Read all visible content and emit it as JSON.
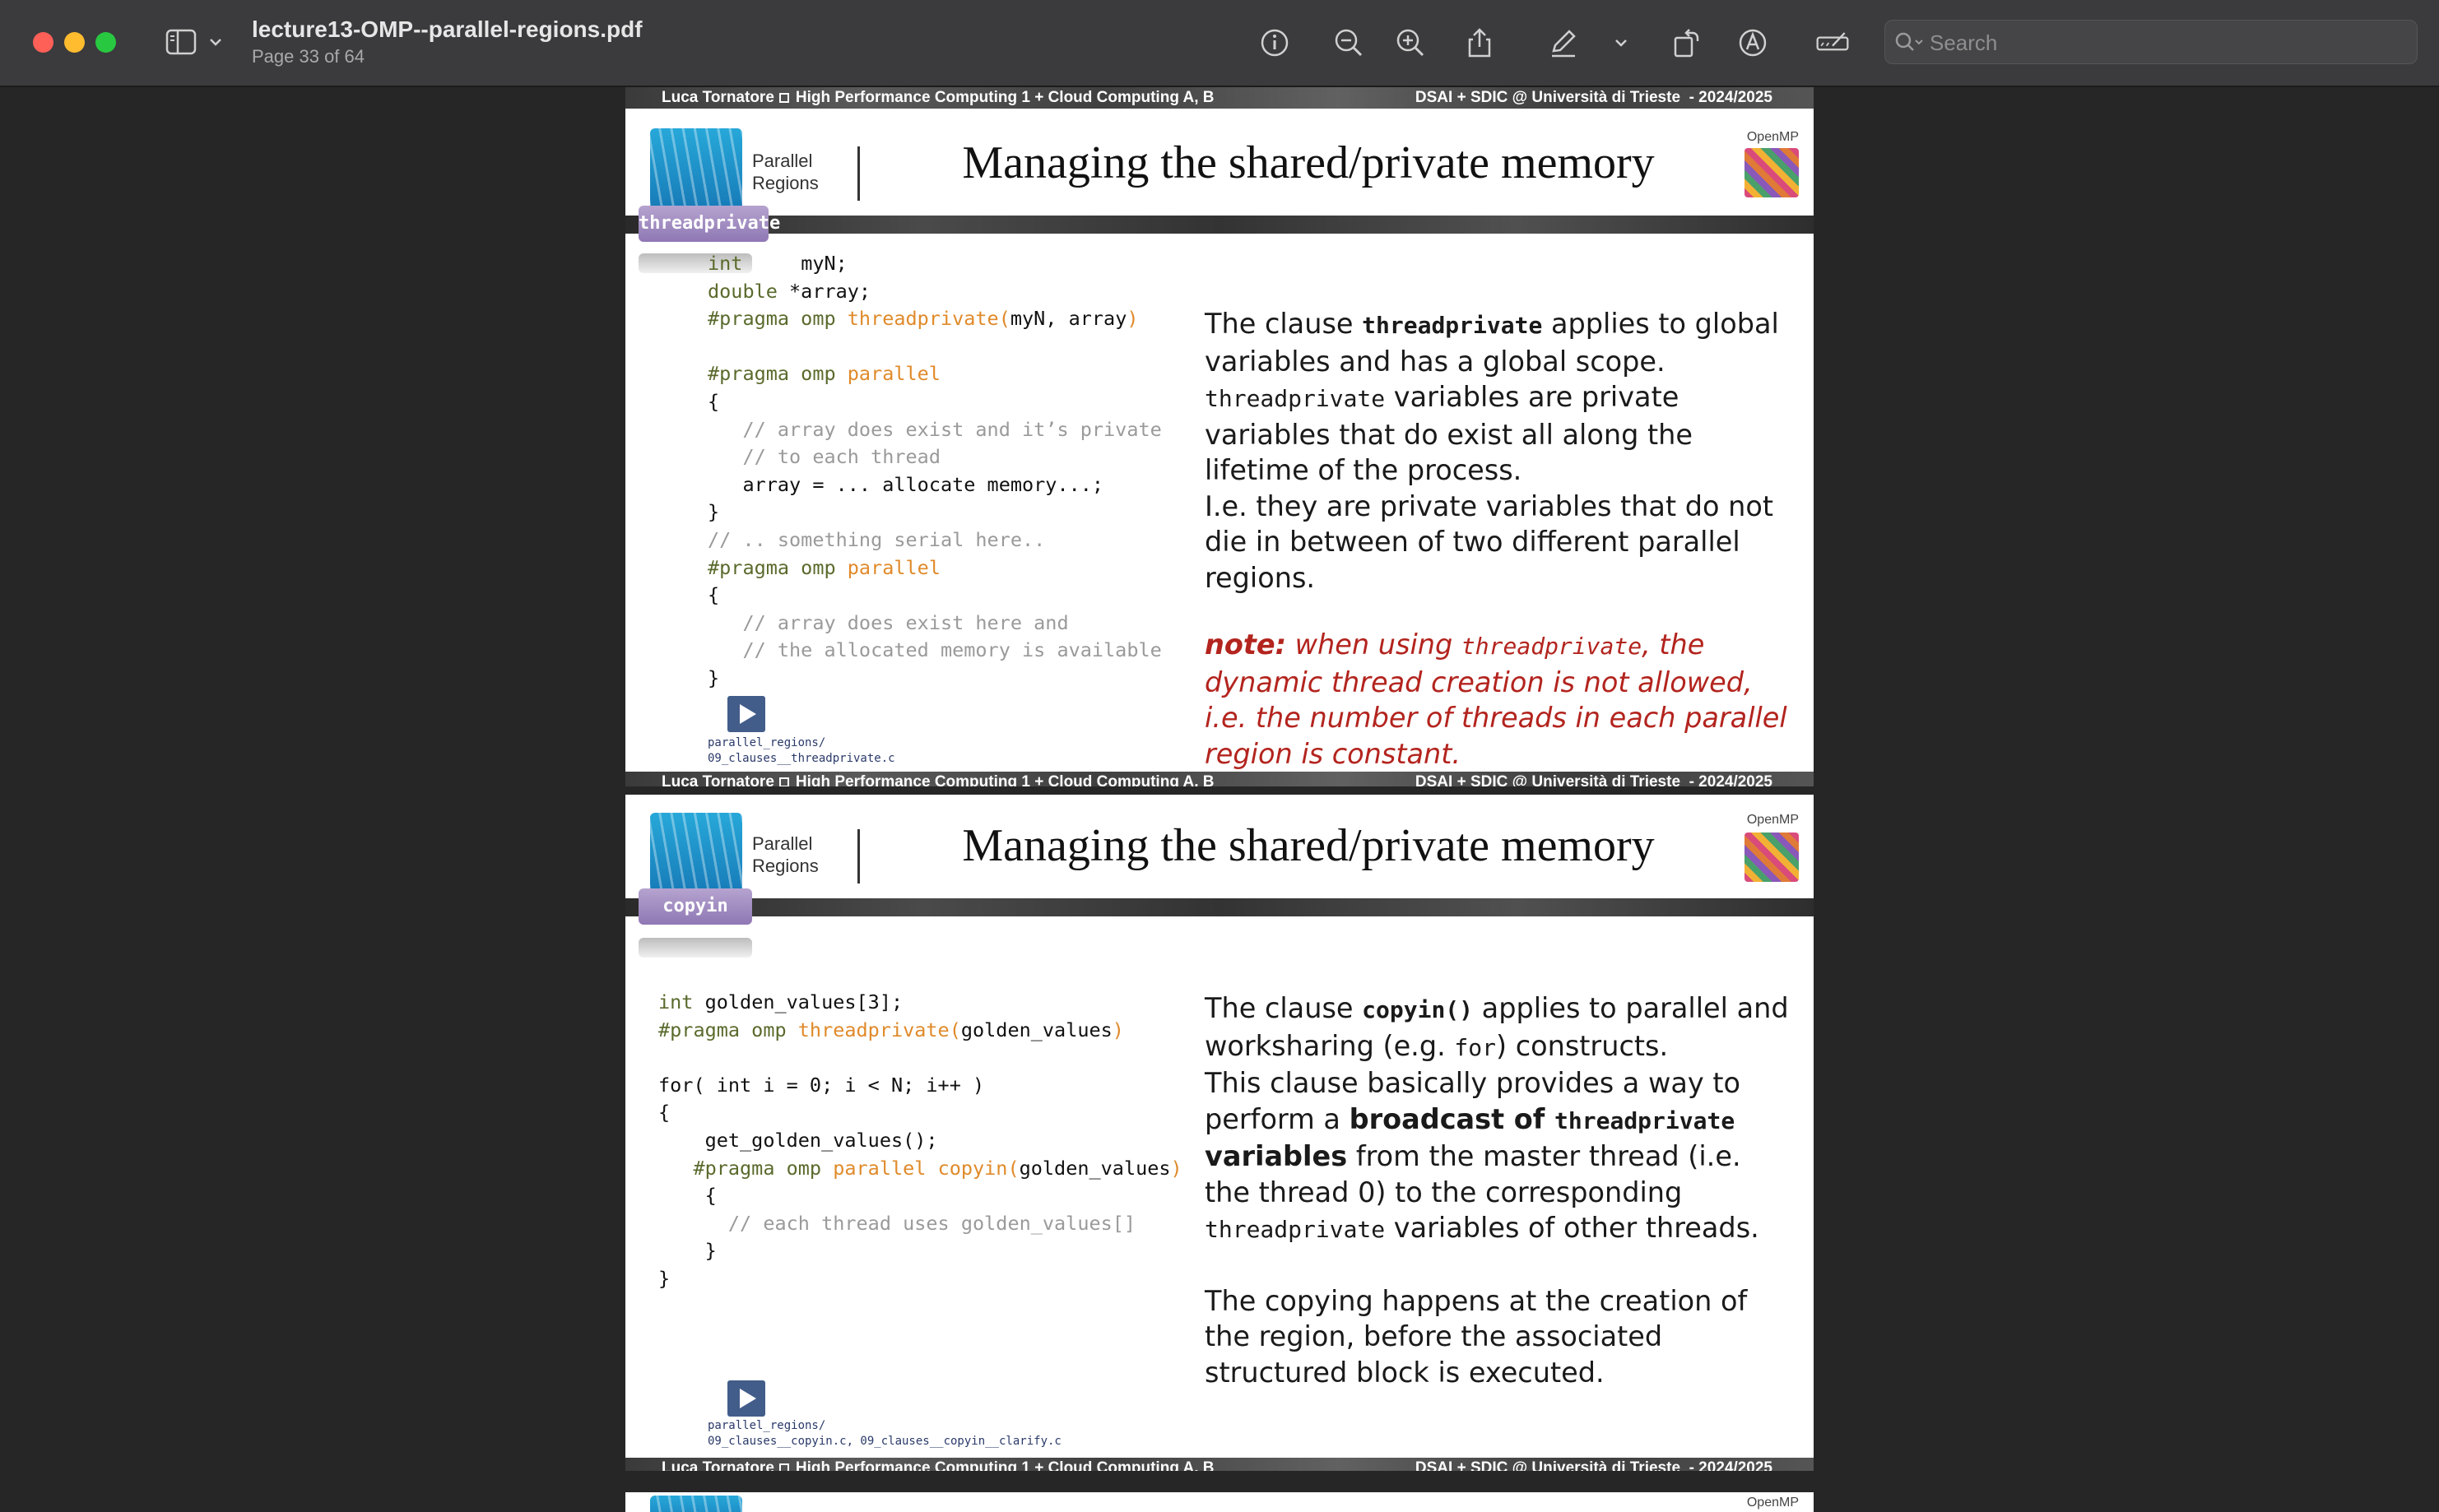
{
  "window": {
    "title": "lecture13-OMP--parallel-regions.pdf",
    "page_info": "Page 33 of 64",
    "search_placeholder": "Search",
    "toolbar_icons": [
      "sidebar-icon",
      "chevron-down-icon",
      "info-icon",
      "zoom-out-icon",
      "zoom-in-icon",
      "share-icon",
      "markup-pen-icon",
      "chevron-down-icon",
      "rotate-icon",
      "annotate-icon",
      "form-fill-icon",
      "search-icon"
    ]
  },
  "footer": {
    "author": "Luca Tornatore",
    "course": "High Performance Computing 1  + Cloud Computing A, B",
    "affiliation": "DSAI + SDIC @ Università di Trieste",
    "year": "- 2024/2025"
  },
  "slide_common": {
    "section_line1": "Parallel",
    "section_line2": "Regions",
    "title": "Managing the shared/private memory",
    "openmp_label": "OpenMP"
  },
  "slide1": {
    "tag": "threadprivate",
    "code": {
      "l1_type": "int",
      "l1_rest": "     myN;",
      "l2_type": "double",
      "l2_rest": " *array;",
      "l3_pragma": "#pragma omp ",
      "l3_fn": "threadprivate(",
      "l3_args": "myN, array",
      "l3_close": ")",
      "l5_pragma": "#pragma omp ",
      "l5_fn": "parallel",
      "l6": "{",
      "l7": "   // array does exist and it’s private",
      "l8": "   // to each thread",
      "l9": "   array = ... allocate memory...;",
      "l10": "}",
      "l11": "// .. something serial here..",
      "l12_pragma": "#pragma omp ",
      "l12_fn": "parallel",
      "l13": "{",
      "l14": "   // array does exist here and",
      "l15": "   // the allocated memory is available",
      "l16": "}"
    },
    "path_line1": "parallel_regions/",
    "path_line2": "09_clauses__threadprivate.c",
    "text": {
      "p1a": "The clause ",
      "p1_kw": "threadprivate",
      "p1b": " applies to global variables and has a global scope.",
      "p2_kw": "threadprivate",
      "p2b": " variables are private variables that do exist all along the lifetime of the process.",
      "p3": "I.e. they are private variables that do not die in between of two different parallel regions."
    },
    "note": {
      "label": "note:",
      "a": " when using ",
      "kw": "threadprivate",
      "b": ", the dynamic thread creation is not allowed, i.e. the number of threads in each parallel region is constant."
    }
  },
  "slide2": {
    "tag": "copyin",
    "code": {
      "l1_type": "int",
      "l1_rest": " golden_values[3];",
      "l2_pragma": "#pragma omp ",
      "l2_fn": "threadprivate(",
      "l2_args": "golden_values",
      "l2_close": ")",
      "l4": "for( int i = 0; i < N; i++ )",
      "l5": "{",
      "l6": "    get_golden_values();",
      "l7_pragma": "   #pragma omp ",
      "l7_fn": "parallel copyin(",
      "l7_args": "golden_values",
      "l7_close": ")",
      "l8": "    {",
      "l9": "      // each thread uses golden_values[]",
      "l10": "    }",
      "l11": "}"
    },
    "path_line1": "parallel_regions/",
    "path_line2": "09_clauses__copyin.c, 09_clauses__copyin__clarify.c",
    "text": {
      "p1a": "The clause ",
      "p1_kw": "copyin()",
      "p1b": " applies to parallel and worksharing (e.g. ",
      "p1_kw2": "for",
      "p1c": ") constructs.",
      "p2a": "This clause basically provides a way to perform a ",
      "p2_bold": "broadcast of ",
      "p2_kw": "threadprivate",
      "p2_bold2": " variables",
      "p2b": " from the master thread (i.e. the thread 0) to the corresponding ",
      "p2_kw2": "threadprivate",
      "p2c": " variables of other threads.",
      "p3": "The copying happens at the creation of the region, before the associated structured block is executed."
    }
  }
}
